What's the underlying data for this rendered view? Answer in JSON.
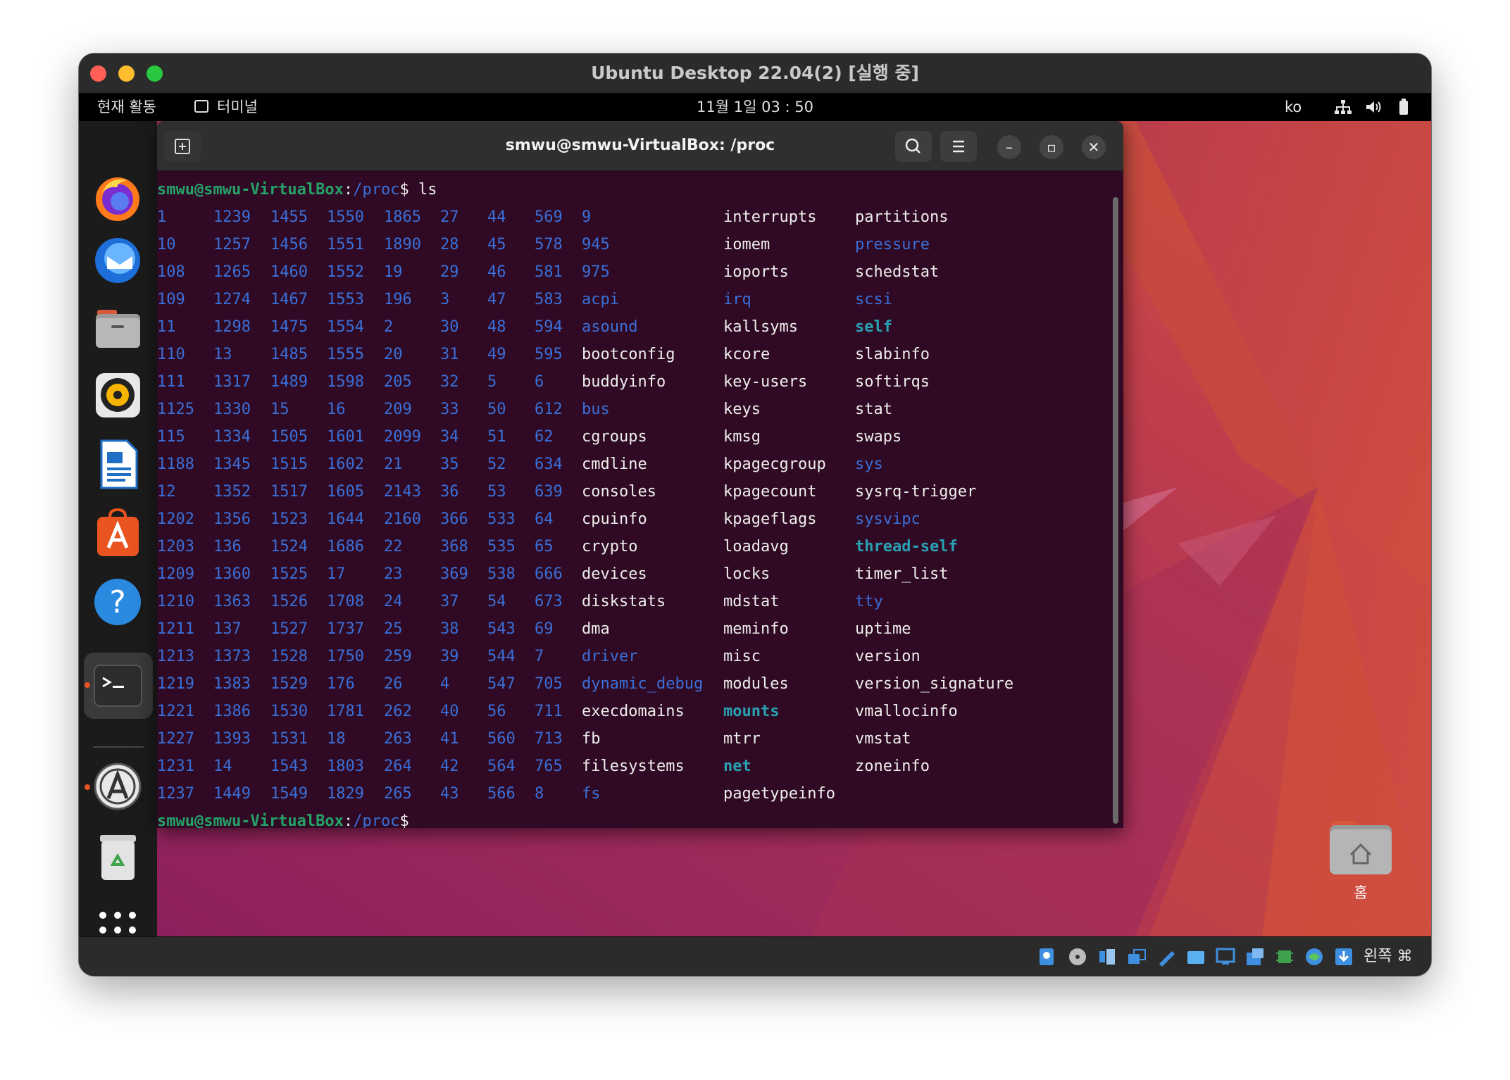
{
  "window": {
    "title": "Ubuntu Desktop 22.04(2) [실행 중]"
  },
  "topbar": {
    "activities": "현재 활동",
    "app_label": "터미널",
    "clock": "11월 1일  03 : 50",
    "lang": "ko"
  },
  "dock": {
    "items": [
      "firefox-icon",
      "thunderbird-icon",
      "files-icon",
      "rhythmbox-icon",
      "libreoffice-writer-icon",
      "app-center-icon",
      "help-icon",
      "terminal-icon",
      "software-updater-icon",
      "trash-icon",
      "show-apps-icon"
    ]
  },
  "terminal": {
    "title": "smwu@smwu-VirtualBox: /proc",
    "prompt_user": "smwu@smwu-VirtualBox",
    "prompt_colon": ":",
    "prompt_path": "/proc",
    "prompt_dollar": "$",
    "command": " ls",
    "rows": [
      [
        "1",
        "1239",
        "1455",
        "1550",
        "1865",
        "27",
        "44",
        "569",
        "9",
        "interrupts",
        "partitions"
      ],
      [
        "10",
        "1257",
        "1456",
        "1551",
        "1890",
        "28",
        "45",
        "578",
        "945",
        "iomem",
        "pressure"
      ],
      [
        "108",
        "1265",
        "1460",
        "1552",
        "19",
        "29",
        "46",
        "581",
        "975",
        "ioports",
        "schedstat"
      ],
      [
        "109",
        "1274",
        "1467",
        "1553",
        "196",
        "3",
        "47",
        "583",
        "acpi",
        "irq",
        "scsi"
      ],
      [
        "11",
        "1298",
        "1475",
        "1554",
        "2",
        "30",
        "48",
        "594",
        "asound",
        "kallsyms",
        "self"
      ],
      [
        "110",
        "13",
        "1485",
        "1555",
        "20",
        "31",
        "49",
        "595",
        "bootconfig",
        "kcore",
        "slabinfo"
      ],
      [
        "111",
        "1317",
        "1489",
        "1598",
        "205",
        "32",
        "5",
        "6",
        "buddyinfo",
        "key-users",
        "softirqs"
      ],
      [
        "1125",
        "1330",
        "15",
        "16",
        "209",
        "33",
        "50",
        "612",
        "bus",
        "keys",
        "stat"
      ],
      [
        "115",
        "1334",
        "1505",
        "1601",
        "2099",
        "34",
        "51",
        "62",
        "cgroups",
        "kmsg",
        "swaps"
      ],
      [
        "1188",
        "1345",
        "1515",
        "1602",
        "21",
        "35",
        "52",
        "634",
        "cmdline",
        "kpagecgroup",
        "sys"
      ],
      [
        "12",
        "1352",
        "1517",
        "1605",
        "2143",
        "36",
        "53",
        "639",
        "consoles",
        "kpagecount",
        "sysrq-trigger"
      ],
      [
        "1202",
        "1356",
        "1523",
        "1644",
        "2160",
        "366",
        "533",
        "64",
        "cpuinfo",
        "kpageflags",
        "sysvipc"
      ],
      [
        "1203",
        "136",
        "1524",
        "1686",
        "22",
        "368",
        "535",
        "65",
        "crypto",
        "loadavg",
        "thread-self"
      ],
      [
        "1209",
        "1360",
        "1525",
        "17",
        "23",
        "369",
        "538",
        "666",
        "devices",
        "locks",
        "timer_list"
      ],
      [
        "1210",
        "1363",
        "1526",
        "1708",
        "24",
        "37",
        "54",
        "673",
        "diskstats",
        "mdstat",
        "tty"
      ],
      [
        "1211",
        "137",
        "1527",
        "1737",
        "25",
        "38",
        "543",
        "69",
        "dma",
        "meminfo",
        "uptime"
      ],
      [
        "1213",
        "1373",
        "1528",
        "1750",
        "259",
        "39",
        "544",
        "7",
        "driver",
        "misc",
        "version"
      ],
      [
        "1219",
        "1383",
        "1529",
        "176",
        "26",
        "4",
        "547",
        "705",
        "dynamic_debug",
        "modules",
        "version_signature"
      ],
      [
        "1221",
        "1386",
        "1530",
        "1781",
        "262",
        "40",
        "56",
        "711",
        "execdomains",
        "mounts",
        "vmallocinfo"
      ],
      [
        "1227",
        "1393",
        "1531",
        "18",
        "263",
        "41",
        "560",
        "713",
        "fb",
        "mtrr",
        "vmstat"
      ],
      [
        "1231",
        "14",
        "1543",
        "1803",
        "264",
        "42",
        "564",
        "765",
        "filesystems",
        "net",
        "zoneinfo"
      ],
      [
        "1237",
        "1449",
        "1549",
        "1829",
        "265",
        "43",
        "566",
        "8",
        "fs",
        "pagetypeinfo",
        ""
      ]
    ],
    "dir_col8": [
      "9",
      "945",
      "975",
      "acpi",
      "asound",
      "bus",
      "driver",
      "dynamic_debug",
      "fs"
    ],
    "dir_col9": [
      "irq"
    ],
    "link_col9": [
      "mounts",
      "net"
    ],
    "dir_col10": [
      "pressure",
      "scsi",
      "sys",
      "sysvipc",
      "tty"
    ],
    "link_col10": [
      "self",
      "thread-self"
    ]
  },
  "desktop": {
    "home_label": "홈"
  },
  "statusbar": {
    "host_key": "왼쪽 ⌘"
  },
  "colors": {
    "terminal_bg": "#300a24",
    "prompt_green": "#26a269",
    "dir_blue": "#3a6fd8",
    "link_cyan": "#2aa1b3",
    "ubuntu_orange": "#e95420"
  }
}
